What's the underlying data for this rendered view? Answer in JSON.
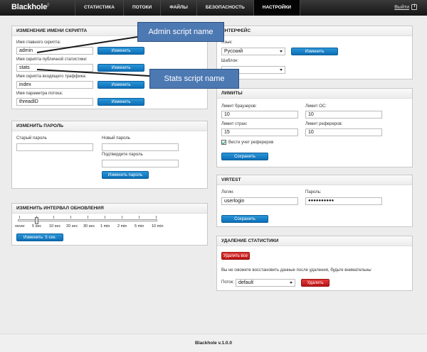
{
  "logo": {
    "text": "Blackhole",
    "mark": "β"
  },
  "nav": [
    {
      "label": "СТАТИСТИКА"
    },
    {
      "label": "ПОТОКИ"
    },
    {
      "label": "ФАЙЛЫ"
    },
    {
      "label": "БЕЗОПАСНОСТЬ"
    },
    {
      "label": "НАСТРОЙКИ"
    }
  ],
  "logout": "Выйти",
  "rename": {
    "title": "ИЗМЕНЕНИЕ ИМЕНИ СКРИПТА",
    "fields": [
      {
        "label": "Имя главного скрипта:",
        "value": "admin",
        "button": "Изменить"
      },
      {
        "label": "Имя скрипта публичной статистики:",
        "value": "stats",
        "button": "Изменить"
      },
      {
        "label": "Имя скрипта входящего траффика:",
        "value": "index",
        "button": "Изменить"
      },
      {
        "label": "Имя параметра потока:",
        "value": "threadID",
        "button": "Изменить"
      }
    ]
  },
  "password": {
    "title": "ИЗМЕНИТЬ ПАРОЛЬ",
    "old_label": "Старый пароль",
    "new_label": "Новый пароль",
    "confirm_label": "Подтвердите пароль",
    "button": "Изменить пароль"
  },
  "interval": {
    "title": "ИЗМЕНИТЬ ИНТЕРВАЛ ОБНОВЛЕНИЯ",
    "ticks": [
      "never",
      "5 sec",
      "10 sec",
      "20 sec",
      "30 sec",
      "1 min",
      "2 min",
      "5 min",
      "10 min"
    ],
    "selected_index": 1,
    "button": "Изменить: 5 сек."
  },
  "interface": {
    "title": "ИНТЕРФЕЙС",
    "language_label": "Язык:",
    "language_value": "Русский",
    "template_label": "Шаблон:",
    "template_value": "",
    "button": "Изменить"
  },
  "limits": {
    "title": "ЛИМИТЫ",
    "browsers_label": "Лимит браузеров:",
    "browsers_value": "10",
    "os_label": "Лимит ОС:",
    "os_value": "10",
    "countries_label": "Лимит стран:",
    "countries_value": "15",
    "referers_label": "Лимит рефереров:",
    "referers_value": "10",
    "track_referers_label": "Вести учет рефереров",
    "track_referers_checked": true,
    "button": "Сохранить"
  },
  "virtest": {
    "title": "VIRTEST",
    "login_label": "Логин:",
    "login_value": "userlogin",
    "password_label": "Пароль:",
    "password_value": "●●●●●●●●●●",
    "button": "Сохранить"
  },
  "delete": {
    "title": "УДАЛЕНИЕ СТАТИСТИКИ",
    "delete_all_button": "Удалить все",
    "warning": "Вы не сможете восстановить данные после удаления, будьте внимательны",
    "stream_label": "Поток:",
    "stream_value": "default",
    "delete_button": "Удалить"
  },
  "callouts": {
    "admin": "Admin script name",
    "stats": "Stats script name"
  },
  "footer": "Blackhole v.1.0.0"
}
